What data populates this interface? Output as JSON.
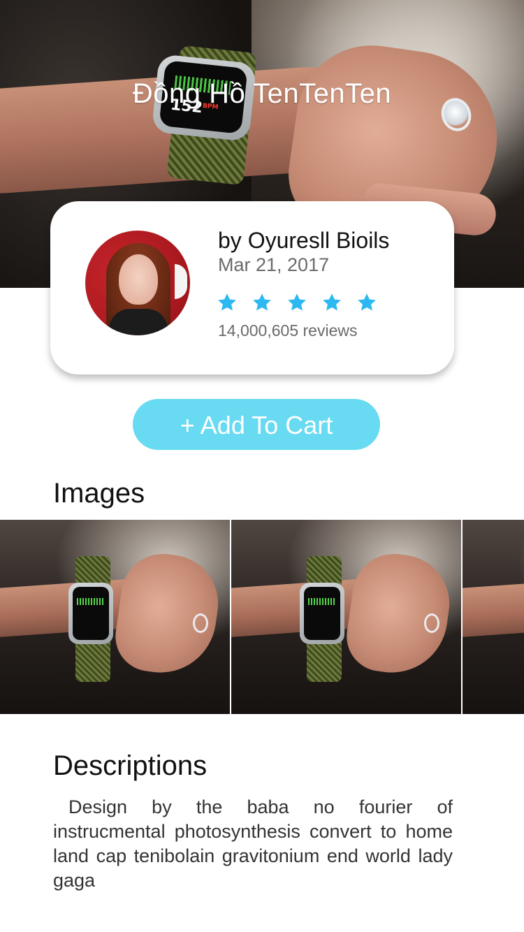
{
  "hero": {
    "title": "Đồng Hồ TenTenTen",
    "image_icon": "smartwatch-on-wrist-photo"
  },
  "product_card": {
    "author": "by Oyuresll Bioils",
    "date": "Mar 21, 2017",
    "rating": 5,
    "rating_max": 5,
    "star_color": "#2cb8f0",
    "reviews": "14,000,605 reviews",
    "avatar_icon": "author-avatar-photo"
  },
  "cart_button": {
    "label": "+ Add To Cart",
    "color": "#68daf1"
  },
  "images": {
    "title": "Images",
    "thumbnails": [
      "smartwatch-photo",
      "smartwatch-photo",
      "smartwatch-photo"
    ]
  },
  "descriptions": {
    "title": "Descriptions",
    "text": "Design by the baba no fourier of instrucmental photosynthesis convert to home land cap  tenibolain gravitonium end world lady gaga"
  }
}
